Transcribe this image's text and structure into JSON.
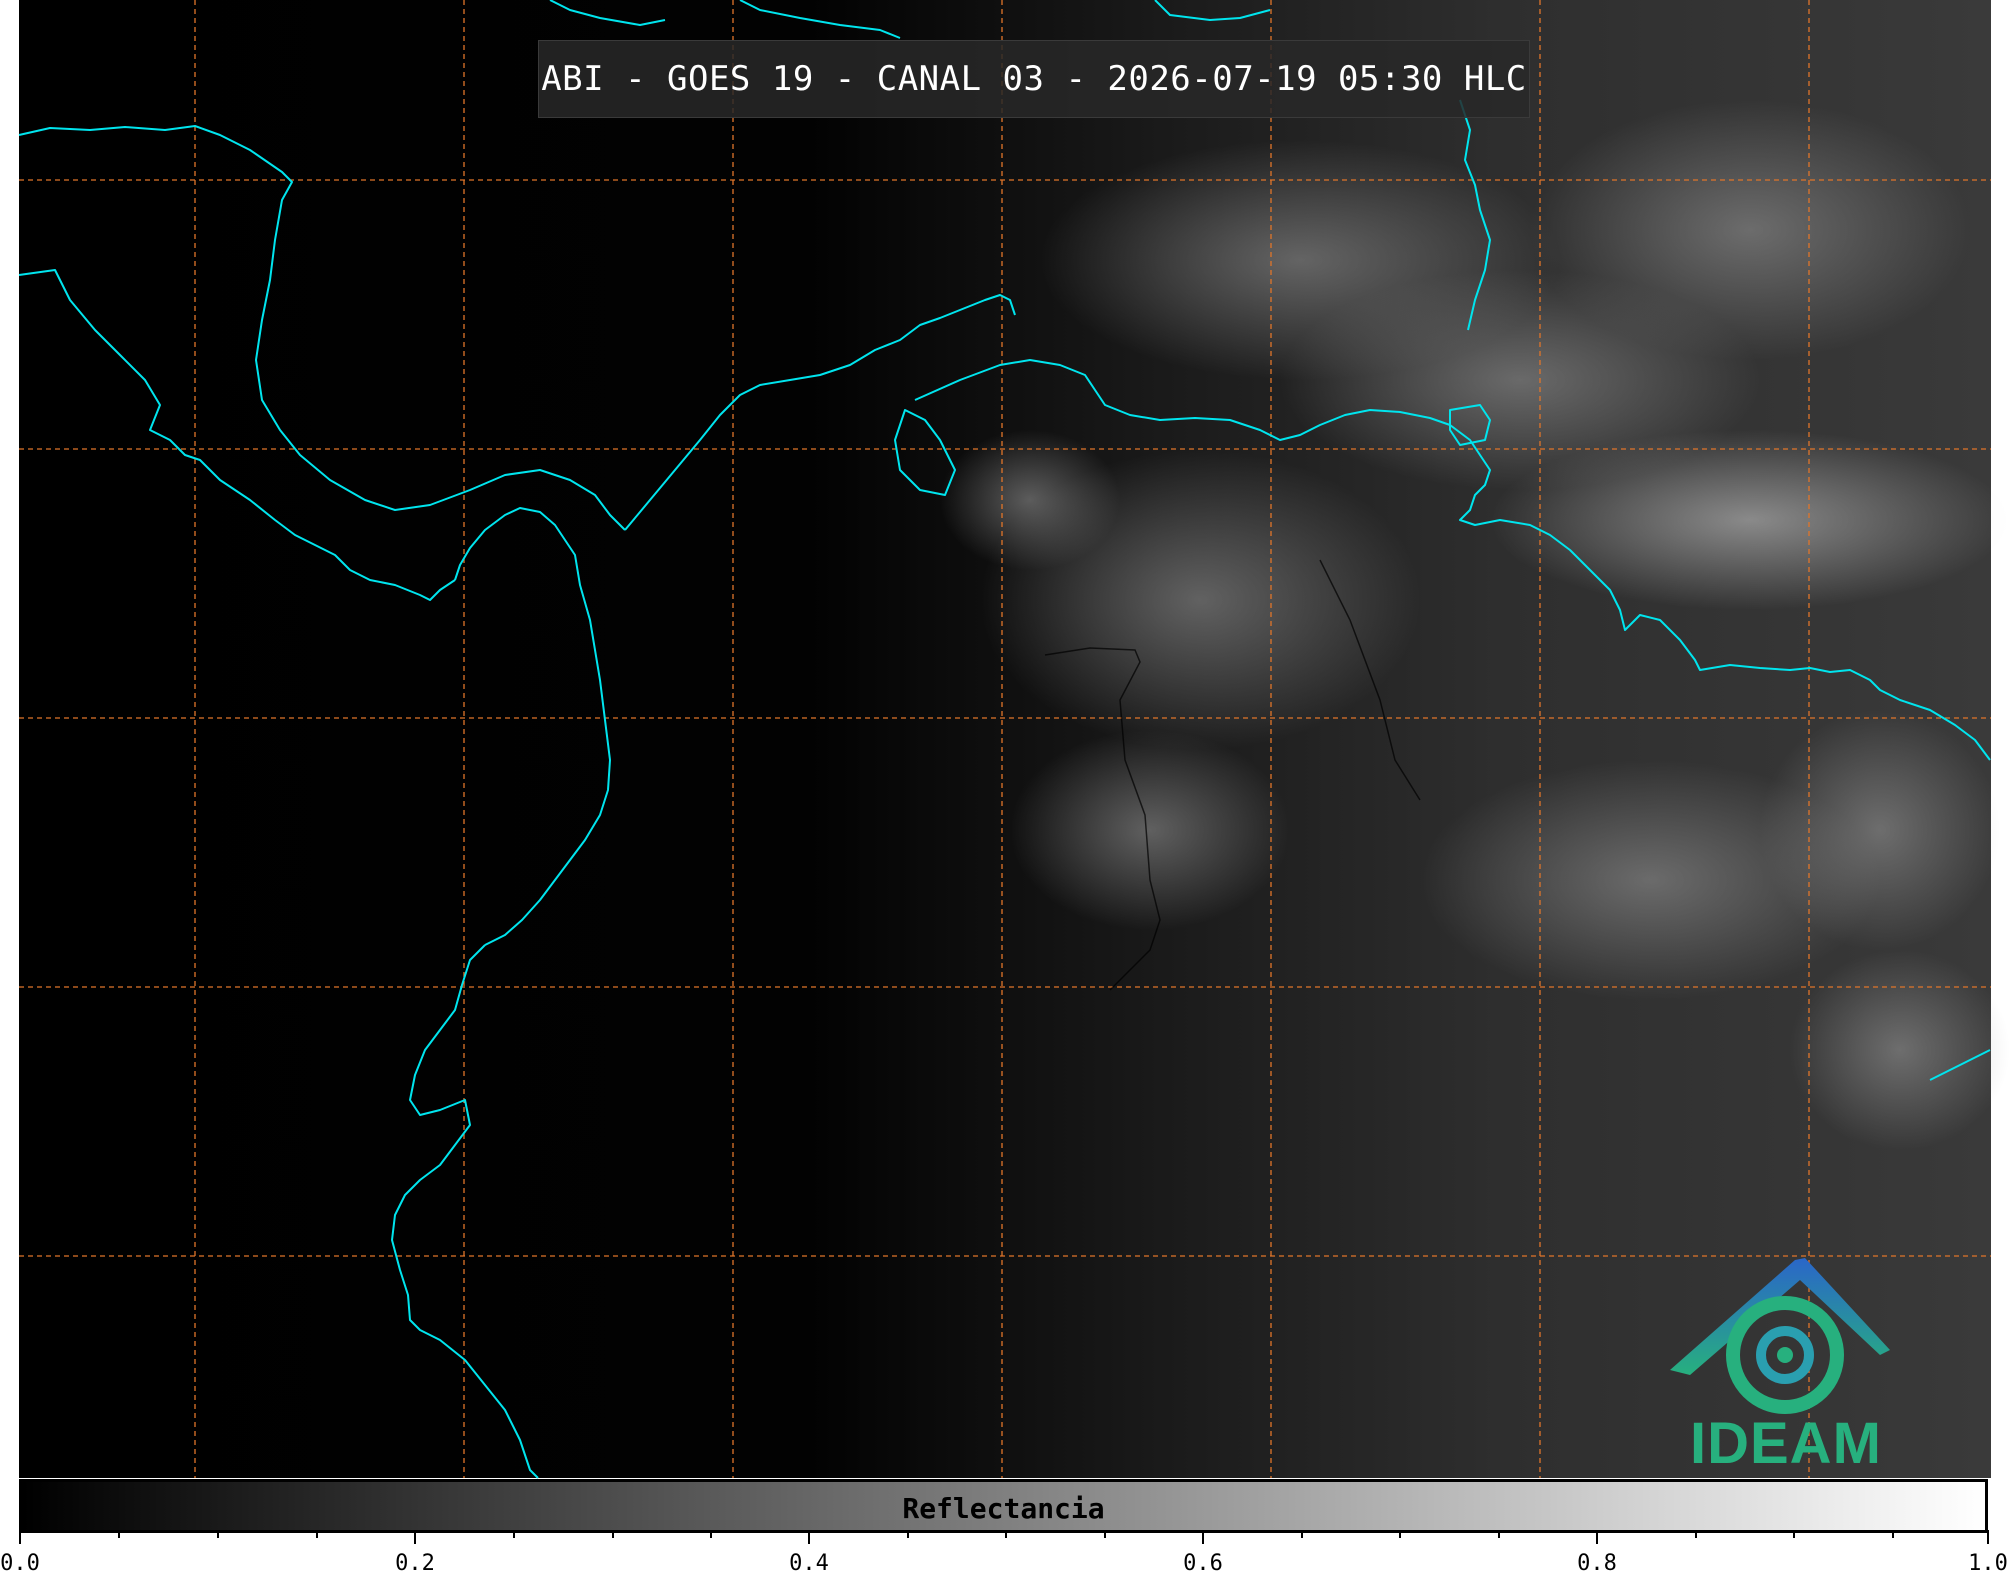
{
  "title": "ABI - GOES 19 - CANAL 03 - 2026-07-19 05:30 HLC",
  "colorbar": {
    "label": "Reflectancia",
    "ticks": [
      "0.0",
      "0.2",
      "0.4",
      "0.6",
      "0.8",
      "1.0"
    ],
    "range": [
      0.0,
      1.0
    ]
  },
  "logo": {
    "text": "IDEAM"
  },
  "colors": {
    "coastline": "#00e5ee",
    "grid": "#e0752a",
    "logo": "#27b07e"
  }
}
